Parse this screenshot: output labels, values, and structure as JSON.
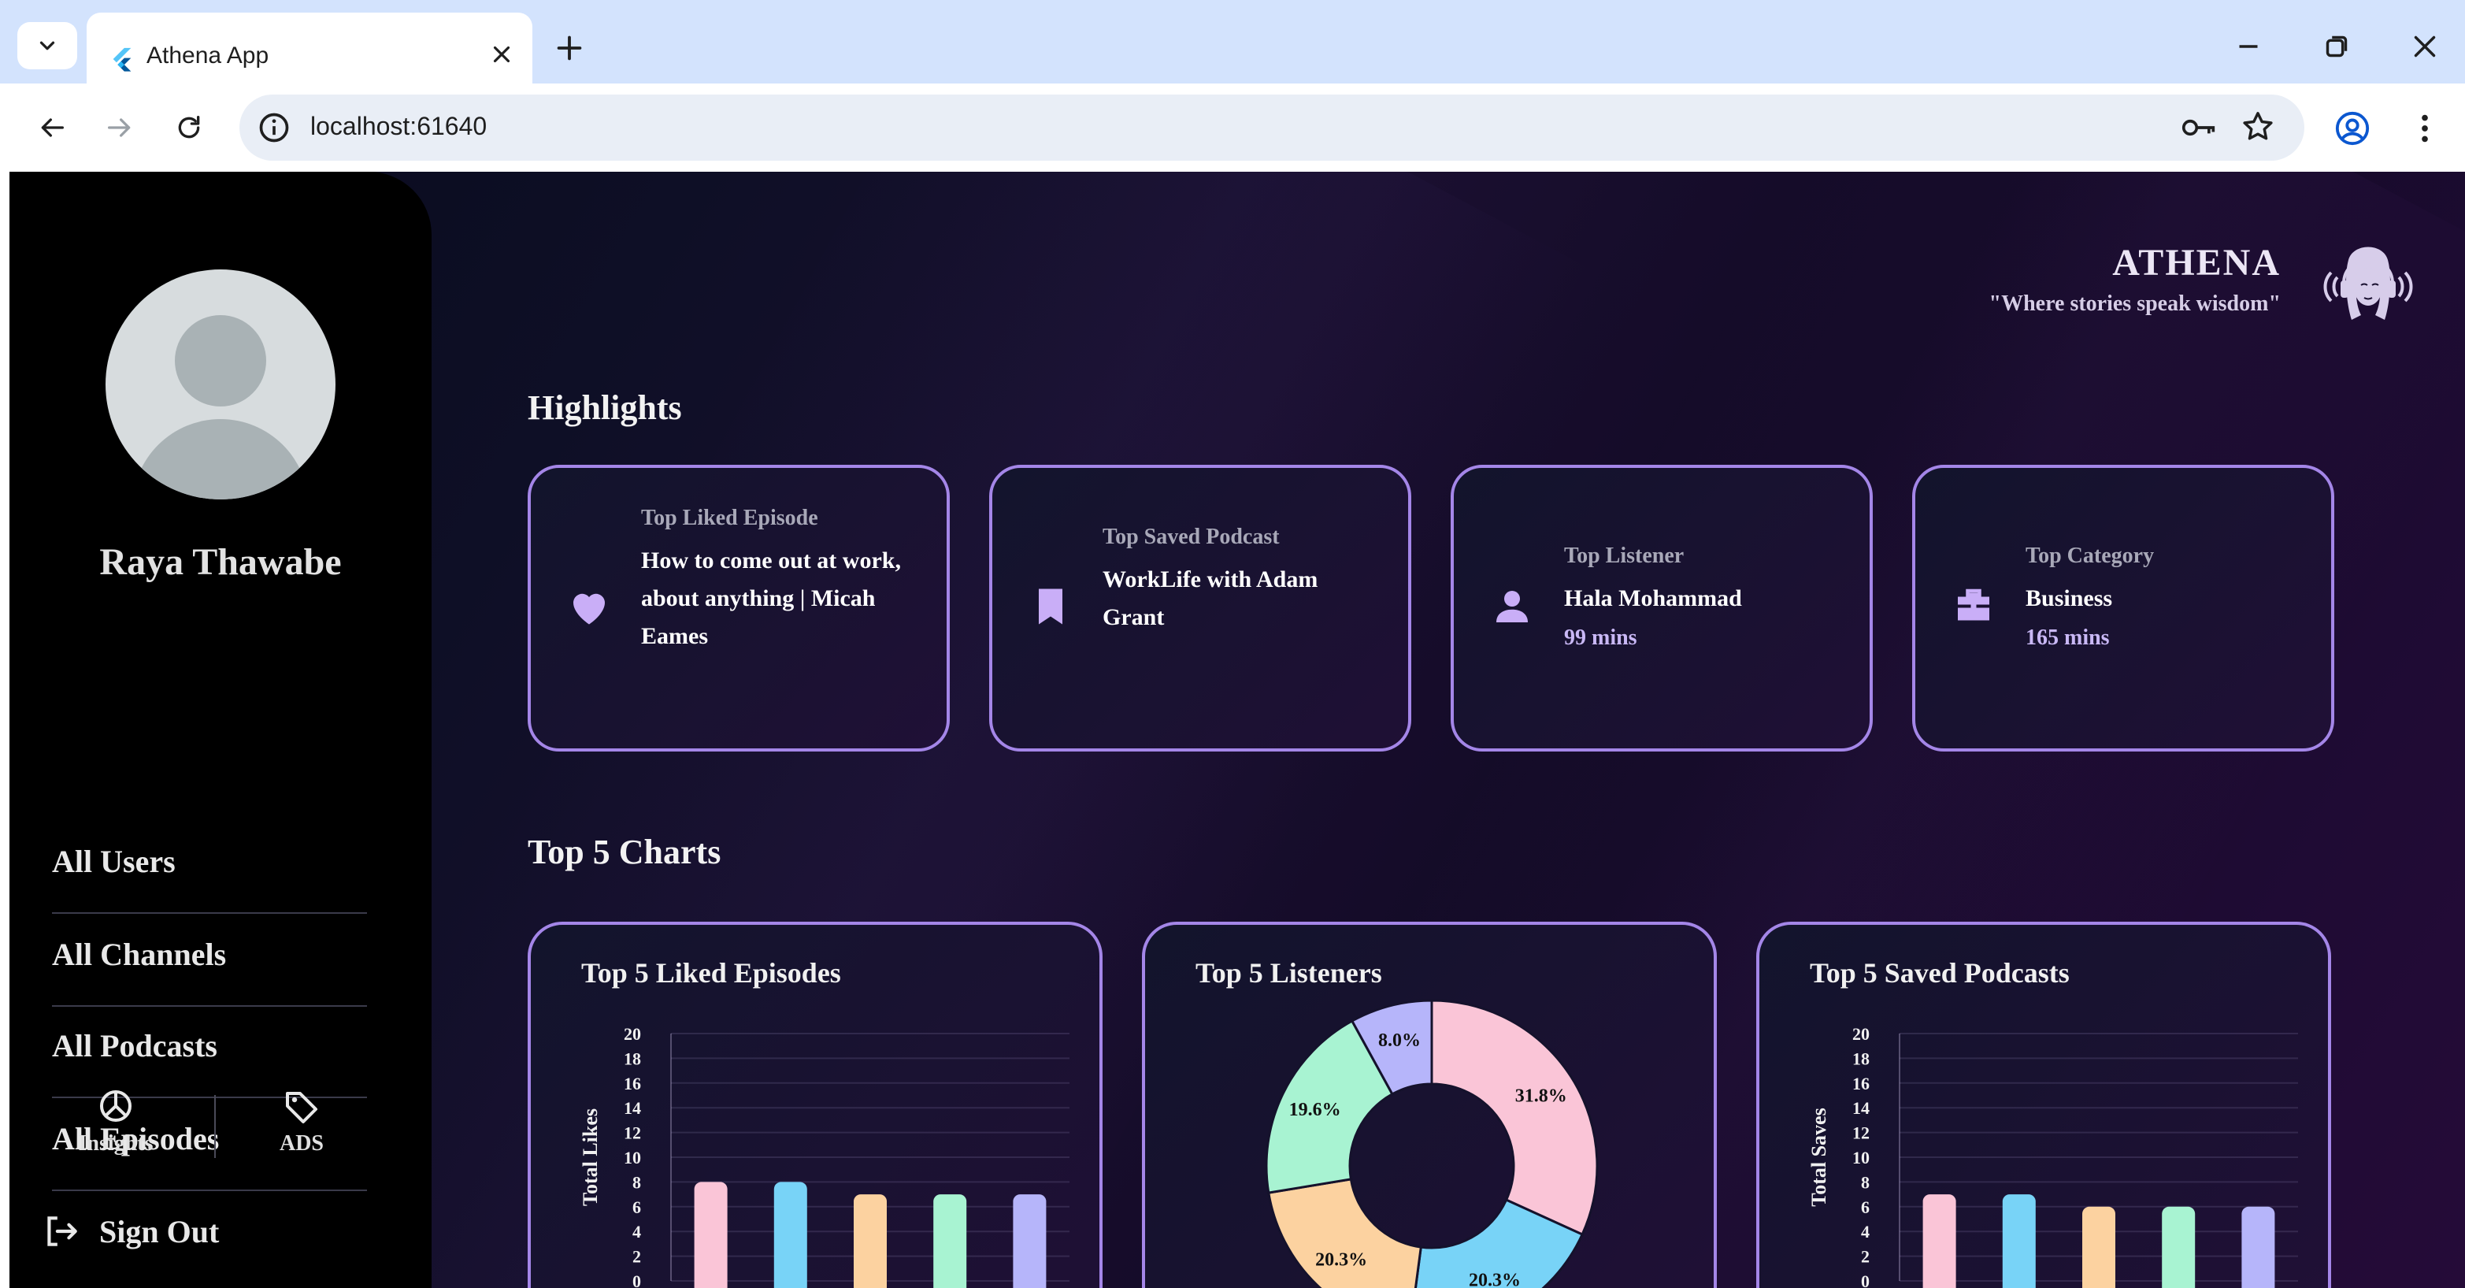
{
  "browser": {
    "tab_title": "Athena App",
    "url": "localhost:61640",
    "icons": [
      "tab-search-icon",
      "flutter-icon",
      "close-icon",
      "plus-icon",
      "minimize-icon",
      "restore-icon",
      "window-close-icon",
      "back-arrow-icon",
      "forward-arrow-icon",
      "reload-icon",
      "site-info-icon",
      "key-icon",
      "star-icon",
      "profile-icon",
      "kebab-menu-icon"
    ]
  },
  "sidebar": {
    "username": "Raya Thawabe",
    "nav": [
      {
        "label": "All Users"
      },
      {
        "label": "All Channels"
      },
      {
        "label": "All Podcasts"
      },
      {
        "label": "All Episodes"
      }
    ],
    "bottom": [
      {
        "label": "Insights",
        "icon": "pie-chart-icon"
      },
      {
        "label": "ADS",
        "icon": "tag-icon"
      }
    ],
    "signout": "Sign Out"
  },
  "brand": {
    "name": "ATHENA",
    "tagline": "\"Where stories speak wisdom\""
  },
  "highlights": {
    "title": "Highlights",
    "cards": [
      {
        "label": "Top Liked Episode",
        "value": "How to come out at work, about anything | Micah Eames",
        "sub": "",
        "icon": "heart-icon"
      },
      {
        "label": "Top Saved Podcast",
        "value": "WorkLife with Adam Grant",
        "sub": "",
        "icon": "bookmark-icon"
      },
      {
        "label": "Top Listener",
        "value": "Hala Mohammad",
        "sub": "99 mins",
        "icon": "person-icon"
      },
      {
        "label": "Top Category",
        "value": "Business",
        "sub": "165 mins",
        "icon": "briefcase-icon"
      }
    ]
  },
  "charts": {
    "title": "Top 5 Charts",
    "colors": [
      "#fac5d7",
      "#78d3f7",
      "#fcd2a0",
      "#a8f3d2",
      "#b6b5fa"
    ],
    "cards": [
      {
        "title": "Top 5 Liked Episodes"
      },
      {
        "title": "Top 5 Listeners"
      },
      {
        "title": "Top 5 Saved Podcasts"
      }
    ]
  },
  "chart_data": [
    {
      "type": "bar",
      "title": "Top 5 Liked Episodes",
      "ylabel": "Total Likes",
      "ylim": [
        0,
        20
      ],
      "yticks": [
        "0",
        "2",
        "4",
        "6",
        "8",
        "10",
        "12",
        "14",
        "16",
        "18",
        "20"
      ],
      "values": [
        8,
        8,
        7,
        7,
        7
      ],
      "grid": true
    },
    {
      "type": "pie",
      "title": "Top 5 Listeners",
      "donut": true,
      "values": [
        31.8,
        20.3,
        20.3,
        19.6,
        8.0
      ],
      "labels": [
        "31.8%",
        "20.3%",
        "20.3%",
        "19.6%",
        "8.0%"
      ]
    },
    {
      "type": "bar",
      "title": "Top 5 Saved Podcasts",
      "ylabel": "Total Saves",
      "ylim": [
        0,
        20
      ],
      "yticks": [
        "0",
        "2",
        "4",
        "6",
        "8",
        "10",
        "12",
        "14",
        "16",
        "18",
        "20"
      ],
      "values": [
        7,
        7,
        6,
        6,
        6
      ],
      "grid": true
    }
  ]
}
